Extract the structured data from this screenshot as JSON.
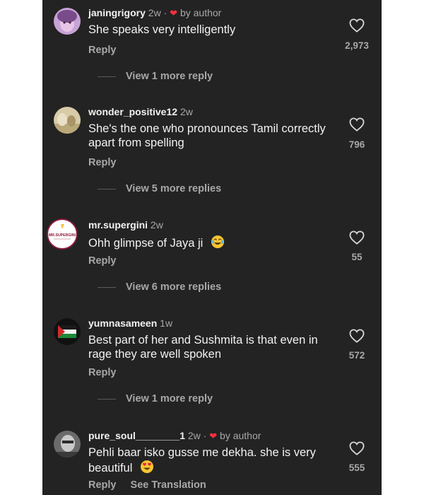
{
  "comments": [
    {
      "username": "janingrigory",
      "age": "2w",
      "by_author": "by author",
      "text": "She speaks very intelligently",
      "reply_label": "Reply",
      "likes": "2,973",
      "view_more": "View 1 more reply"
    },
    {
      "username": "wonder_positive12",
      "age": "2w",
      "text": "She's the one who pronounces Tamil correctly apart from spelling",
      "reply_label": "Reply",
      "likes": "796",
      "view_more": "View 5 more replies"
    },
    {
      "username": "mr.supergini",
      "age": "2w",
      "text": "Ohh glimpse of Jaya ji",
      "reply_label": "Reply",
      "likes": "55",
      "view_more": "View 6 more replies",
      "avatar_text": "MR.SUPERGINI"
    },
    {
      "username": "yumnasameen",
      "age": "1w",
      "text": "Best part of her and Sushmita is that even in rage they are well spoken",
      "reply_label": "Reply",
      "likes": "572",
      "view_more": "View 1 more reply"
    },
    {
      "username": "pure_soul________1",
      "age": "2w",
      "by_author": "by author",
      "text": "Pehli baar isko gusse me dekha. she is very beautiful",
      "reply_label": "Reply",
      "see_translation": "See Translation",
      "likes": "555"
    }
  ],
  "colors": {
    "background": "#232323",
    "text_primary": "#f2f2f2",
    "text_secondary": "#a8a8a8",
    "author_heart": "#ff3040"
  },
  "icons": {
    "like": "heart-outline-icon",
    "author_like": "heart-filled-icon",
    "laugh_emoji": "tears-of-joy-emoji",
    "love_emoji": "heart-eyes-emoji"
  }
}
